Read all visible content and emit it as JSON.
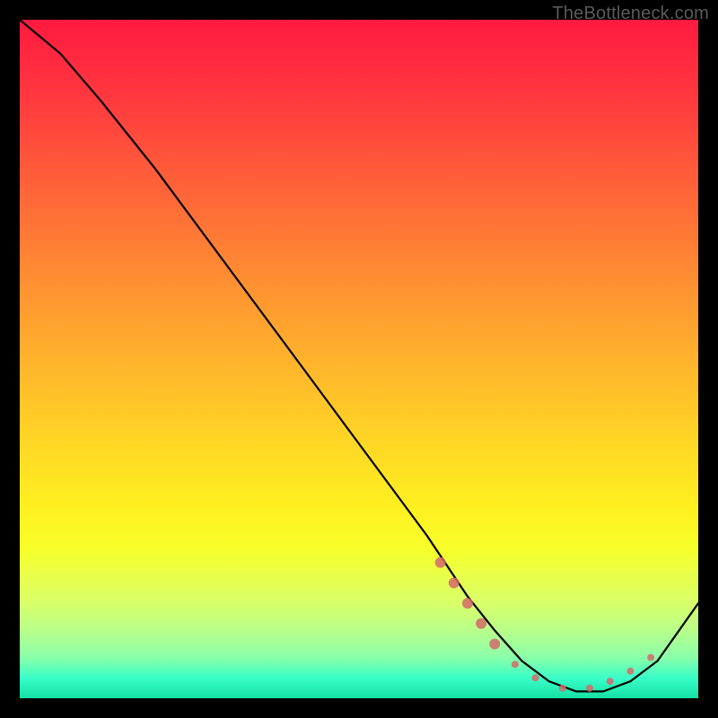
{
  "attribution": "TheBottleneck.com",
  "colors": {
    "background": "#000000",
    "gradient_top": "#ff1a3f",
    "gradient_mid": "#ffd626",
    "gradient_bottom": "#14e0a4",
    "curve": "#000000",
    "marker": "#d46a6a"
  },
  "chart_data": {
    "type": "line",
    "title": "",
    "xlabel": "",
    "ylabel": "",
    "xlim": [
      0,
      100
    ],
    "ylim": [
      0,
      100
    ],
    "legend": false,
    "grid": false,
    "series": [
      {
        "name": "curve",
        "x": [
          0,
          6,
          12,
          20,
          30,
          40,
          50,
          60,
          66,
          70,
          74,
          78,
          82,
          86,
          90,
          94,
          100
        ],
        "y": [
          100,
          95,
          88,
          78,
          64.5,
          51,
          37.5,
          24,
          15,
          10,
          5.5,
          2.5,
          1,
          1,
          2.5,
          5.5,
          14
        ]
      }
    ],
    "markers": {
      "name": "highlight-points",
      "color": "#d46a6a",
      "x": [
        62,
        64,
        66,
        68,
        70,
        73,
        76,
        80,
        84,
        87,
        90,
        93
      ],
      "y": [
        20,
        17,
        14,
        11,
        8,
        5,
        3,
        1.5,
        1.5,
        2.5,
        4,
        6
      ]
    }
  }
}
